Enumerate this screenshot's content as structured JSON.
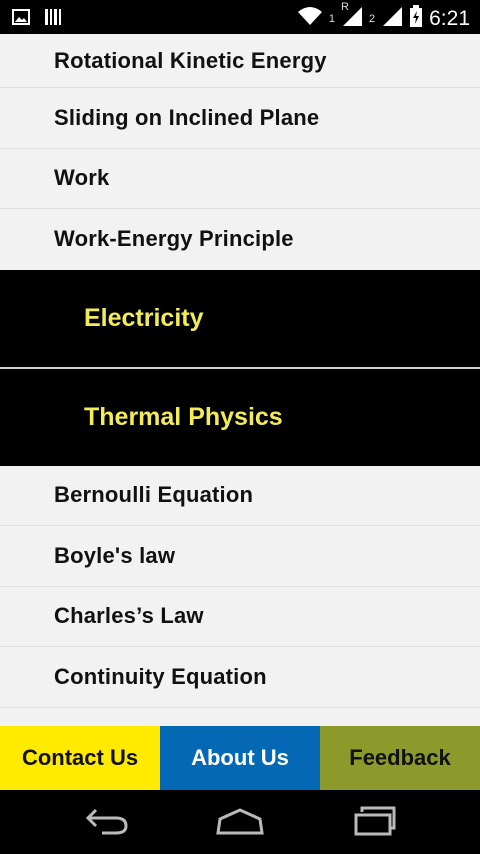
{
  "status_bar": {
    "time": "6:21",
    "sim1_label": "1",
    "roaming_label": "R",
    "sim2_label": "2",
    "icons": [
      "image-notification-icon",
      "barcode-notification-icon",
      "wifi-icon",
      "signal-sim1-icon",
      "signal-sim2-icon",
      "battery-charging-icon"
    ]
  },
  "topics": {
    "mechanics_items": [
      "Rotational Kinetic Energy",
      "Sliding on Inclined Plane",
      "Work",
      "Work-Energy Principle"
    ],
    "section_electricity": "Electricity",
    "section_thermal": "Thermal Physics",
    "thermal_items": [
      "Bernoulli Equation",
      "Boyle's law",
      "Charles’s Law",
      "Continuity Equation"
    ]
  },
  "bottom_bar": {
    "contact_label": "Contact Us",
    "about_label": "About Us",
    "feedback_label": "Feedback",
    "colors": {
      "contact": "#ffea00",
      "about": "#0468b4",
      "feedback": "#8b9a2a"
    }
  },
  "nav_bar": {
    "icons": [
      "back-icon",
      "home-icon",
      "recent-apps-icon"
    ]
  },
  "colors": {
    "section_text": "#f3ec5a",
    "section_bg": "#000000",
    "row_bg": "#f2f2f2"
  }
}
